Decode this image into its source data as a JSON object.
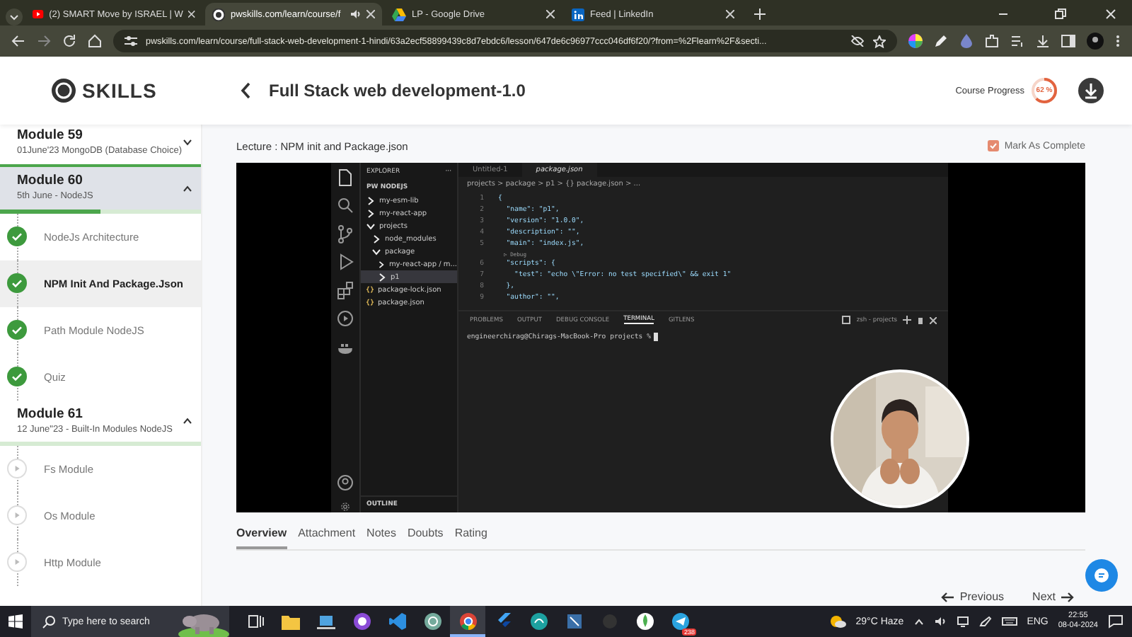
{
  "browser": {
    "tabs": [
      {
        "title": "(2) SMART Move by ISRAEL | W",
        "kind": "youtube",
        "selected": false,
        "audio": false
      },
      {
        "title": "pwskills.com/learn/course/f",
        "kind": "pw",
        "selected": true,
        "audio": true
      },
      {
        "title": "LP - Google Drive",
        "kind": "drive",
        "selected": false,
        "audio": false
      },
      {
        "title": "Feed | LinkedIn",
        "kind": "linkedin",
        "selected": false,
        "audio": false
      }
    ],
    "url": "pwskills.com/learn/course/full-stack-web-development-1-hindi/63a2ecf58899439c8d7ebdc6/lesson/647de6c96977ccc046df6f20/?from=%2Flearn%2F&secti..."
  },
  "header": {
    "logo": "SKILLS",
    "title": "Full Stack web development-1.0",
    "progress_label": "Course Progress",
    "progress": {
      "level": 0.62,
      "reading": "62 %"
    }
  },
  "sidebar": {
    "modules": [
      {
        "title": "Module 59",
        "subtitle": "01June'23 MongoDB (Database Choice)",
        "expanded": false,
        "selected": false,
        "level": 1
      },
      {
        "title": "Module 60",
        "subtitle": "5th June - NodeJS",
        "expanded": true,
        "selected": true,
        "level": 0.5,
        "lessons": [
          {
            "title": "NodeJs Architecture",
            "done": true,
            "selected": false
          },
          {
            "title": "NPM Init And Package.Json",
            "done": true,
            "selected": true
          },
          {
            "title": "Path Module NodeJS",
            "done": true,
            "selected": false
          },
          {
            "title": "Quiz",
            "done": true,
            "selected": false
          }
        ]
      },
      {
        "title": "Module 61",
        "subtitle": "12 June\"23 - Built-In Modules NodeJS",
        "expanded": true,
        "selected": false,
        "level": 0,
        "lessons": [
          {
            "title": "Fs Module",
            "done": false,
            "selected": false
          },
          {
            "title": "Os Module",
            "done": false,
            "selected": false
          },
          {
            "title": "Http Module",
            "done": false,
            "selected": false
          }
        ]
      }
    ]
  },
  "lecture": {
    "title": "Lecture : NPM init and Package.json",
    "mark_complete": {
      "label": "Mark As Complete",
      "checked": true
    },
    "vscode": {
      "explorer_title": "EXPLORER",
      "explorer_more": "···",
      "project": "PW NODEJS",
      "tree": [
        {
          "label": "my-esm-lib",
          "kind": "folder",
          "expanded": false,
          "selected": false
        },
        {
          "label": "my-react-app",
          "kind": "folder",
          "expanded": false,
          "selected": false
        },
        {
          "label": "projects",
          "kind": "folder",
          "expanded": true,
          "selected": false,
          "children": [
            {
              "label": "node_modules",
              "kind": "folder",
              "expanded": false,
              "selected": false
            },
            {
              "label": "package",
              "kind": "folder",
              "expanded": true,
              "selected": false,
              "children": [
                {
                  "label": "my-react-app / m...",
                  "kind": "folder",
                  "expanded": false,
                  "selected": false
                },
                {
                  "label": "p1",
                  "kind": "folder",
                  "expanded": false,
                  "selected": true
                }
              ]
            }
          ]
        },
        {
          "label": "package-lock.json",
          "kind": "file",
          "selected": false
        },
        {
          "label": "package.json",
          "kind": "file",
          "selected": false
        }
      ],
      "outline": "OUTLINE",
      "editor_tabs": [
        {
          "label": "Untitled-1",
          "selected": false
        },
        {
          "label": "package.json",
          "selected": true
        }
      ],
      "breadcrumb": "projects > package > p1 > {} package.json > ...",
      "code": [
        {
          "kind": "line",
          "n": "1",
          "text": "{"
        },
        {
          "kind": "line",
          "n": "2",
          "text": "  \"name\": \"p1\","
        },
        {
          "kind": "line",
          "n": "3",
          "text": "  \"version\": \"1.0.0\","
        },
        {
          "kind": "line",
          "n": "4",
          "text": "  \"description\": \"\","
        },
        {
          "kind": "line",
          "n": "5",
          "text": "  \"main\": \"index.js\","
        },
        {
          "kind": "lens",
          "text": "▷ Debug"
        },
        {
          "kind": "line",
          "n": "6",
          "text": "  \"scripts\": {"
        },
        {
          "kind": "line",
          "n": "7",
          "text": "    \"test\": \"echo \\\"Error: no test specified\\\" && exit 1\""
        },
        {
          "kind": "line",
          "n": "8",
          "text": "  },"
        },
        {
          "kind": "line",
          "n": "9",
          "text": "  \"author\": \"\","
        }
      ],
      "panel_tabs": [
        {
          "label": "PROBLEMS",
          "selected": false
        },
        {
          "label": "OUTPUT",
          "selected": false
        },
        {
          "label": "DEBUG CONSOLE",
          "selected": false
        },
        {
          "label": "TERMINAL",
          "selected": true
        },
        {
          "label": "GITLENS",
          "selected": false
        }
      ],
      "shell": "zsh - projects",
      "prompt": "engineerchirag@Chirags-MacBook-Pro projects %"
    },
    "tabs": [
      {
        "label": "Overview",
        "selected": true
      },
      {
        "label": "Attachment",
        "selected": false
      },
      {
        "label": "Notes",
        "selected": false
      },
      {
        "label": "Doubts",
        "selected": false
      },
      {
        "label": "Rating",
        "selected": false
      }
    ],
    "previous": "Previous",
    "next": "Next"
  },
  "taskbar": {
    "search_placeholder": "Type here to search",
    "apps": [
      {
        "kind": "taskview",
        "active": false
      },
      {
        "kind": "folder",
        "active": false
      },
      {
        "kind": "laptop",
        "active": false
      },
      {
        "kind": "github",
        "active": false
      },
      {
        "kind": "vscode",
        "active": false
      },
      {
        "kind": "chatgpt",
        "active": false
      },
      {
        "kind": "chrome",
        "active": true
      },
      {
        "kind": "flutter",
        "active": false
      },
      {
        "kind": "edge",
        "active": false
      },
      {
        "kind": "tool",
        "active": false
      },
      {
        "kind": "blank",
        "active": false
      },
      {
        "kind": "mongodb",
        "active": false
      },
      {
        "kind": "telegram",
        "active": false,
        "badge": "238"
      }
    ],
    "weather": "29°C  Haze",
    "language": "ENG",
    "time": "22:55",
    "date": "08-04-2024"
  }
}
